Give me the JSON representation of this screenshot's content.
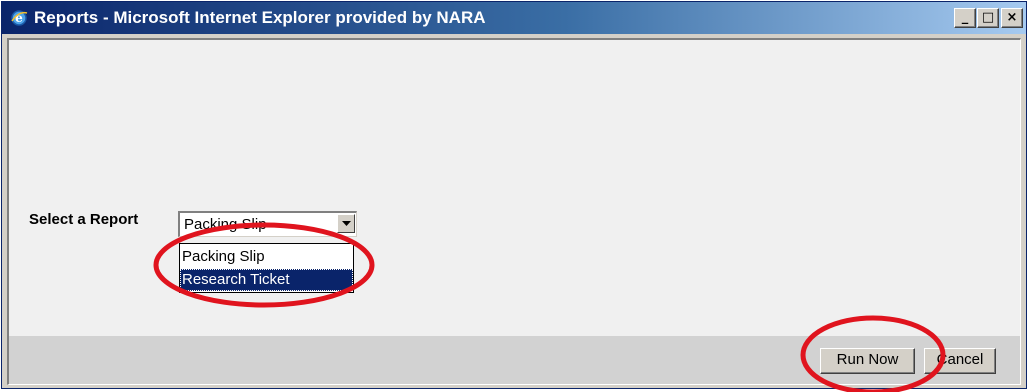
{
  "window": {
    "title": "Reports - Microsoft Internet Explorer provided by NARA",
    "minimize_glyph": "_",
    "maximize_glyph": "□",
    "close_glyph": "×"
  },
  "form": {
    "label": "Select a Report",
    "select": {
      "selected_value": "Packing Slip",
      "options": [
        "Packing Slip",
        "Research Ticket"
      ],
      "highlighted_option": "Research Ticket"
    }
  },
  "footer": {
    "run_now_label": "Run Now",
    "cancel_label": "Cancel"
  },
  "colors": {
    "title_bar": "#0a246a",
    "highlight": "#0a246a",
    "annotation_circle": "#e0141e"
  }
}
